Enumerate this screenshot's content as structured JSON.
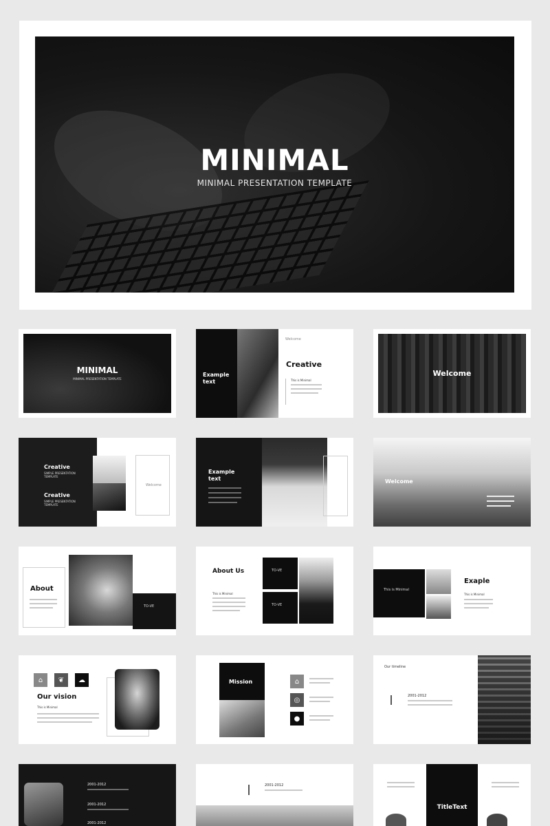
{
  "hero": {
    "title": "MINIMAL",
    "subtitle": "MINIMAL PRESENTATION TEMPLATE"
  },
  "slides": {
    "s1": {
      "title": "MINIMAL",
      "subtitle": "MINIMAL PRESENTATION TEMPLATE"
    },
    "s2": {
      "left_title": "Example text",
      "title": "Creative",
      "small_label": "This is Minimal"
    },
    "s3": {
      "title": "Welcome"
    },
    "s4": {
      "title_1": "Creative",
      "sub_1": "SIMPLE PRESENTATION TEMPLATE",
      "title_2": "Creative",
      "sub_2": "SIMPLE PRESENTATION TEMPLATE",
      "box_label": "Welcome"
    },
    "s5": {
      "title": "Example text"
    },
    "s6": {
      "title": "Welcome"
    },
    "s7": {
      "title": "About",
      "box_label": "TO-VE"
    },
    "s8": {
      "title": "About Us",
      "small_label": "This is Minimal",
      "box_label_1": "TO-VE",
      "box_label_2": "TO-VE"
    },
    "s9": {
      "title": "Exaple",
      "small_label": "This is Minimal",
      "box_label": "This is Minimal"
    },
    "s10": {
      "title": "Our vision",
      "small_label": "This is Minimal"
    },
    "s11": {
      "title": "Mission"
    },
    "s12": {
      "label": "Our timeline",
      "year": "2001-2012"
    },
    "s13": {
      "year_1": "2001-2012",
      "year_2": "2001-2012",
      "year_3": "2001-2012"
    },
    "s14": {
      "year": "2001-2012"
    },
    "s15": {
      "title": "TitleText"
    }
  },
  "colors": {
    "dark": "#1c1c1c",
    "black": "#0a0a0a",
    "white": "#ffffff"
  }
}
